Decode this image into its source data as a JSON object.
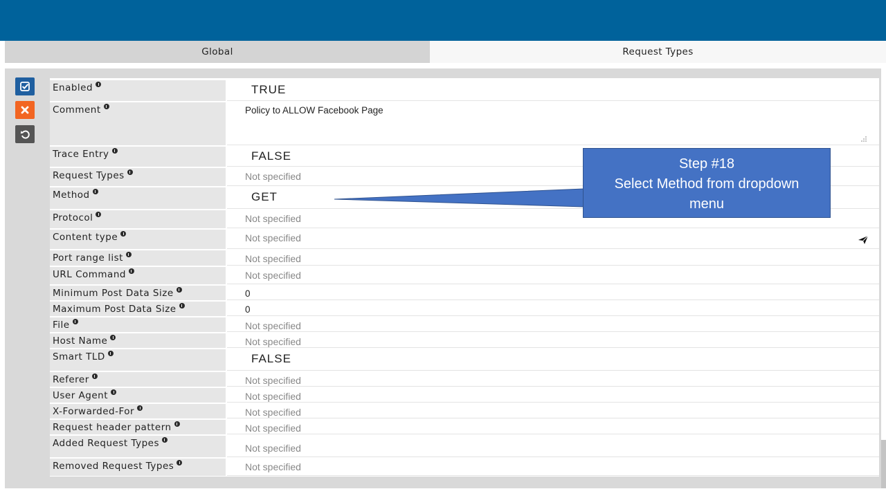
{
  "tabs": {
    "global": "Global",
    "request_types": "Request Types"
  },
  "toolbar": {
    "confirm_icon": "checkbox-check-icon",
    "cancel_icon": "close-x-icon",
    "reset_icon": "undo-icon"
  },
  "colors": {
    "header": "#00629b",
    "confirm": "#1f5fa0",
    "cancel": "#f26522",
    "reset": "#555555",
    "callout": "#4472c4"
  },
  "fields": {
    "enabled": {
      "label": "Enabled",
      "value": "TRUE"
    },
    "comment": {
      "label": "Comment",
      "value": "Policy to ALLOW Facebook Page"
    },
    "trace_entry": {
      "label": "Trace Entry",
      "value": "FALSE"
    },
    "request_types": {
      "label": "Request Types",
      "value": "Not specified"
    },
    "method": {
      "label": "Method",
      "value": "GET"
    },
    "protocol": {
      "label": "Protocol",
      "value": "Not specified"
    },
    "content_type": {
      "label": "Content type",
      "value": "Not specified"
    },
    "port_range_list": {
      "label": "Port range list",
      "value": "Not specified"
    },
    "url_command": {
      "label": "URL Command",
      "value": "Not specified"
    },
    "min_post_data": {
      "label": "Minimum Post Data Size",
      "value": "0"
    },
    "max_post_data": {
      "label": "Maximum Post Data Size",
      "value": "0"
    },
    "file": {
      "label": "File",
      "value": "Not specified"
    },
    "host_name": {
      "label": "Host Name",
      "value": "Not specified"
    },
    "smart_tld": {
      "label": "Smart TLD",
      "value": "FALSE"
    },
    "referer": {
      "label": "Referer",
      "value": "Not specified"
    },
    "user_agent": {
      "label": "User Agent",
      "value": "Not specified"
    },
    "x_forwarded_for": {
      "label": "X-Forwarded-For",
      "value": "Not specified"
    },
    "request_header_pattern": {
      "label": "Request header pattern",
      "value": "Not specified"
    },
    "added_request_types": {
      "label": "Added Request Types",
      "value": "Not specified"
    },
    "removed_request_types": {
      "label": "Removed Request Types",
      "value": "Not specified"
    }
  },
  "callout": {
    "line1": "Step #18",
    "line2": "Select Method from dropdown",
    "line3": "menu"
  }
}
